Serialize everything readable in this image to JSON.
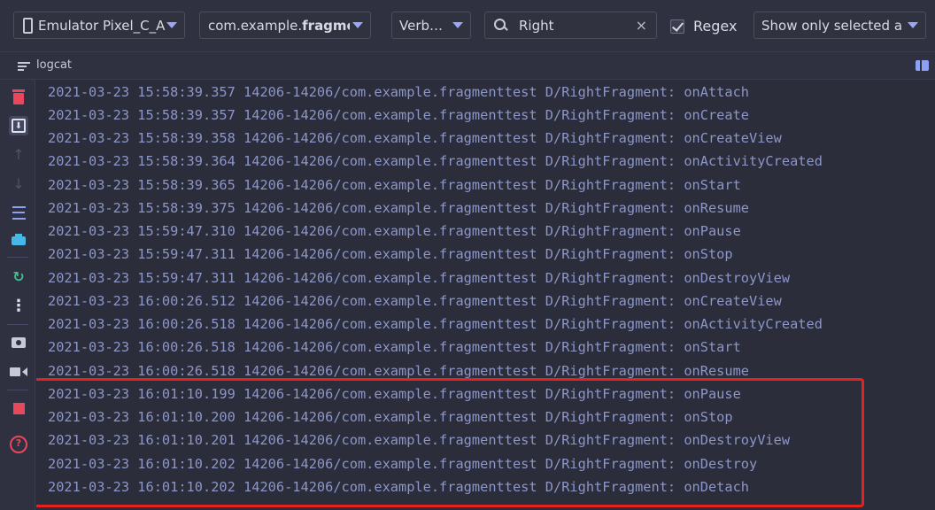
{
  "toolbar": {
    "device": "Emulator Pixel_C_A",
    "process_prefix": "com.example.",
    "process_bold": "fragme",
    "level": "Verb…",
    "search_value": "Right",
    "clear_icon": "×",
    "regex_label": "Regex",
    "regex_checked": true,
    "filter": "Show only selected ap"
  },
  "subheader": {
    "title": "logcat"
  },
  "gutter_icons": [
    "trash-icon",
    "scroll-to-end-icon",
    "up-arrow-icon",
    "down-arrow-icon",
    "soft-wrap-icon",
    "print-icon",
    "restart-icon",
    "more-icon",
    "screenshot-icon",
    "screen-record-icon",
    "stop-icon",
    "help-icon"
  ],
  "log_lines": [
    "2021-03-23 15:58:39.357 14206-14206/com.example.fragmenttest D/RightFragment: onAttach",
    "2021-03-23 15:58:39.357 14206-14206/com.example.fragmenttest D/RightFragment: onCreate",
    "2021-03-23 15:58:39.358 14206-14206/com.example.fragmenttest D/RightFragment: onCreateView",
    "2021-03-23 15:58:39.364 14206-14206/com.example.fragmenttest D/RightFragment: onActivityCreated",
    "2021-03-23 15:58:39.365 14206-14206/com.example.fragmenttest D/RightFragment: onStart",
    "2021-03-23 15:58:39.375 14206-14206/com.example.fragmenttest D/RightFragment: onResume",
    "2021-03-23 15:59:47.310 14206-14206/com.example.fragmenttest D/RightFragment: onPause",
    "2021-03-23 15:59:47.311 14206-14206/com.example.fragmenttest D/RightFragment: onStop",
    "2021-03-23 15:59:47.311 14206-14206/com.example.fragmenttest D/RightFragment: onDestroyView",
    "2021-03-23 16:00:26.512 14206-14206/com.example.fragmenttest D/RightFragment: onCreateView",
    "2021-03-23 16:00:26.518 14206-14206/com.example.fragmenttest D/RightFragment: onActivityCreated",
    "2021-03-23 16:00:26.518 14206-14206/com.example.fragmenttest D/RightFragment: onStart",
    "2021-03-23 16:00:26.518 14206-14206/com.example.fragmenttest D/RightFragment: onResume",
    "2021-03-23 16:01:10.199 14206-14206/com.example.fragmenttest D/RightFragment: onPause",
    "2021-03-23 16:01:10.200 14206-14206/com.example.fragmenttest D/RightFragment: onStop",
    "2021-03-23 16:01:10.201 14206-14206/com.example.fragmenttest D/RightFragment: onDestroyView",
    "2021-03-23 16:01:10.202 14206-14206/com.example.fragmenttest D/RightFragment: onDestroy",
    "2021-03-23 16:01:10.202 14206-14206/com.example.fragmenttest D/RightFragment: onDetach"
  ],
  "colors": {
    "highlight": "#e4231f",
    "log_text": "#8d96c9",
    "accent": "#9aa7f5"
  }
}
